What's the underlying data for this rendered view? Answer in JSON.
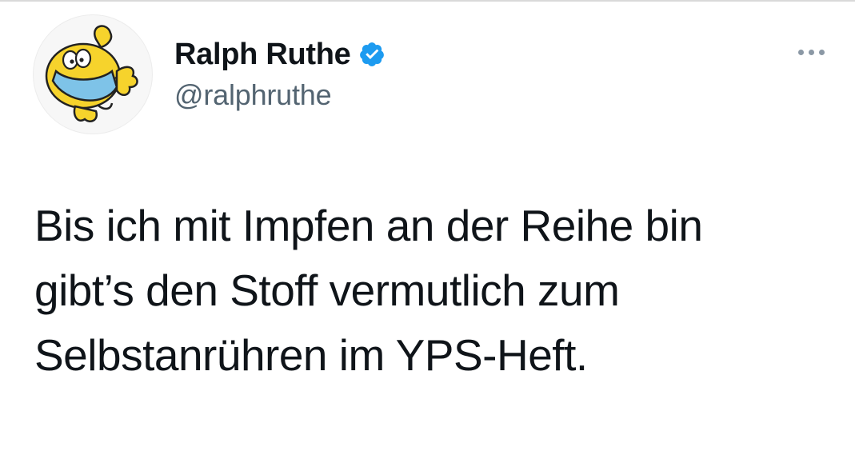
{
  "author": {
    "display_name": "Ralph Ruthe",
    "handle": "@ralphruthe",
    "verified": true,
    "avatar_icon": "cartoon-character-with-mask-avatar"
  },
  "tweet": {
    "text_lines": [
      "Bis ich mit Impfen an der Reihe bin",
      "gibt’s den Stoff vermutlich zum",
      "Selbstanrühren im YPS-Heft."
    ]
  },
  "icons": {
    "verified": "verified-badge-icon",
    "more": "more-options-icon"
  },
  "colors": {
    "verified_blue": "#1d9bf0",
    "handle_gray": "#536471",
    "text": "#0f1419",
    "avatar_yellow": "#f6d32c",
    "mask_blue": "#7ec3e8"
  }
}
